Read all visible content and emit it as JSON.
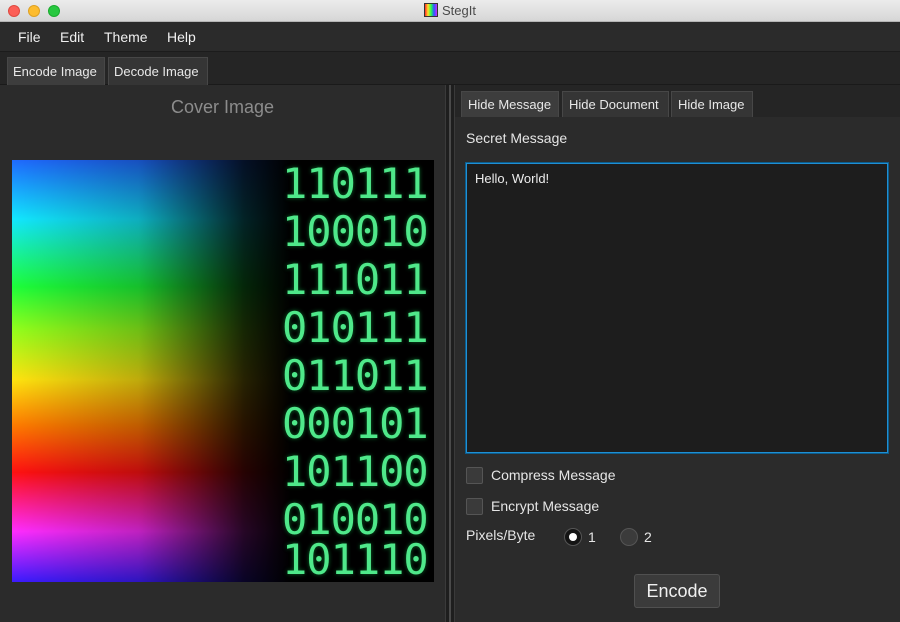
{
  "window": {
    "title": "StegIt"
  },
  "menu": [
    "File",
    "Edit",
    "Theme",
    "Help"
  ],
  "outer_tabs": [
    {
      "label": "Encode Image",
      "active": true
    },
    {
      "label": "Decode Image",
      "active": false
    }
  ],
  "left": {
    "cover_title": "Cover Image",
    "binary_rows": [
      "110111",
      "100010",
      "111011",
      "010111",
      "011011",
      "000101",
      "101100",
      "010010",
      "101110"
    ]
  },
  "inner_tabs": [
    {
      "label": "Hide Message",
      "active": true
    },
    {
      "label": "Hide Document",
      "active": false
    },
    {
      "label": "Hide Image",
      "active": false
    }
  ],
  "form": {
    "secret_label": "Secret Message",
    "message": "Hello, World!",
    "compress_label": "Compress Message",
    "compress_checked": false,
    "encrypt_label": "Encrypt Message",
    "encrypt_checked": false,
    "pixels_label": "Pixels/Byte",
    "pixel_options": [
      "1",
      "2"
    ],
    "pixel_selected": "1",
    "encode_label": "Encode"
  },
  "colors": {
    "focus_border": "#1f8fd4",
    "binary_green": "#4fe88a"
  }
}
